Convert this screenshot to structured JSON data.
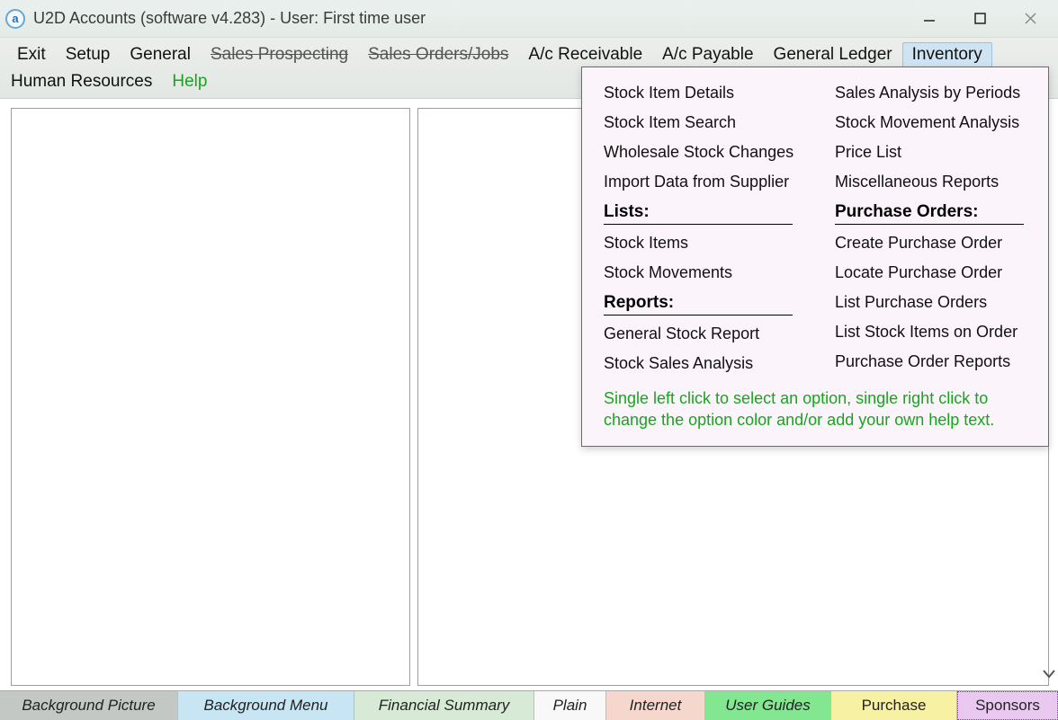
{
  "titlebar": {
    "icon_letter": "a",
    "title": "U2D Accounts (software v4.283) -  User: First time user"
  },
  "menu": {
    "row1": {
      "exit": "Exit",
      "setup": "Setup",
      "general": "General",
      "sales_prospecting": "Sales Prospecting",
      "sales_orders": "Sales Orders/Jobs",
      "ac_receivable": "A/c Receivable",
      "ac_payable": "A/c Payable",
      "general_ledger": "General Ledger",
      "inventory": "Inventory"
    },
    "row2": {
      "hr": "Human Resources",
      "help": "Help"
    }
  },
  "dropdown": {
    "col1_top": {
      "stock_item_details": "Stock Item Details",
      "stock_item_search": "Stock Item Search",
      "wholesale_stock_changes": "Wholesale Stock Changes",
      "import_data": "Import Data from Supplier"
    },
    "col1_lists_header": "Lists:",
    "col1_lists": {
      "stock_items": "Stock Items",
      "stock_movements": "Stock Movements"
    },
    "col1_reports_header": "Reports:",
    "col1_reports": {
      "general_stock_report": "General Stock Report",
      "stock_sales_analysis": "Stock Sales Analysis"
    },
    "col2_top": {
      "sales_analysis_periods": "Sales Analysis by Periods",
      "stock_movement_analysis": "Stock Movement Analysis",
      "price_list": "Price List",
      "misc_reports": "Miscellaneous Reports"
    },
    "col2_po_header": "Purchase Orders:",
    "col2_po": {
      "create_po": "Create Purchase Order",
      "locate_po": "Locate Purchase Order",
      "list_po": "List Purchase Orders",
      "list_stock_on_order": "List Stock Items on Order",
      "po_reports": "Purchase Order Reports"
    },
    "hint": "Single left click to select an option, single right click to change the option color and/or add your own help text."
  },
  "tabs": {
    "bg_picture": "Background Picture",
    "bg_menu": "Background Menu",
    "fin_summary": "Financial Summary",
    "plain": "Plain",
    "internet": "Internet",
    "user_guides": "User Guides",
    "purchase": "Purchase",
    "sponsors": "Sponsors"
  }
}
